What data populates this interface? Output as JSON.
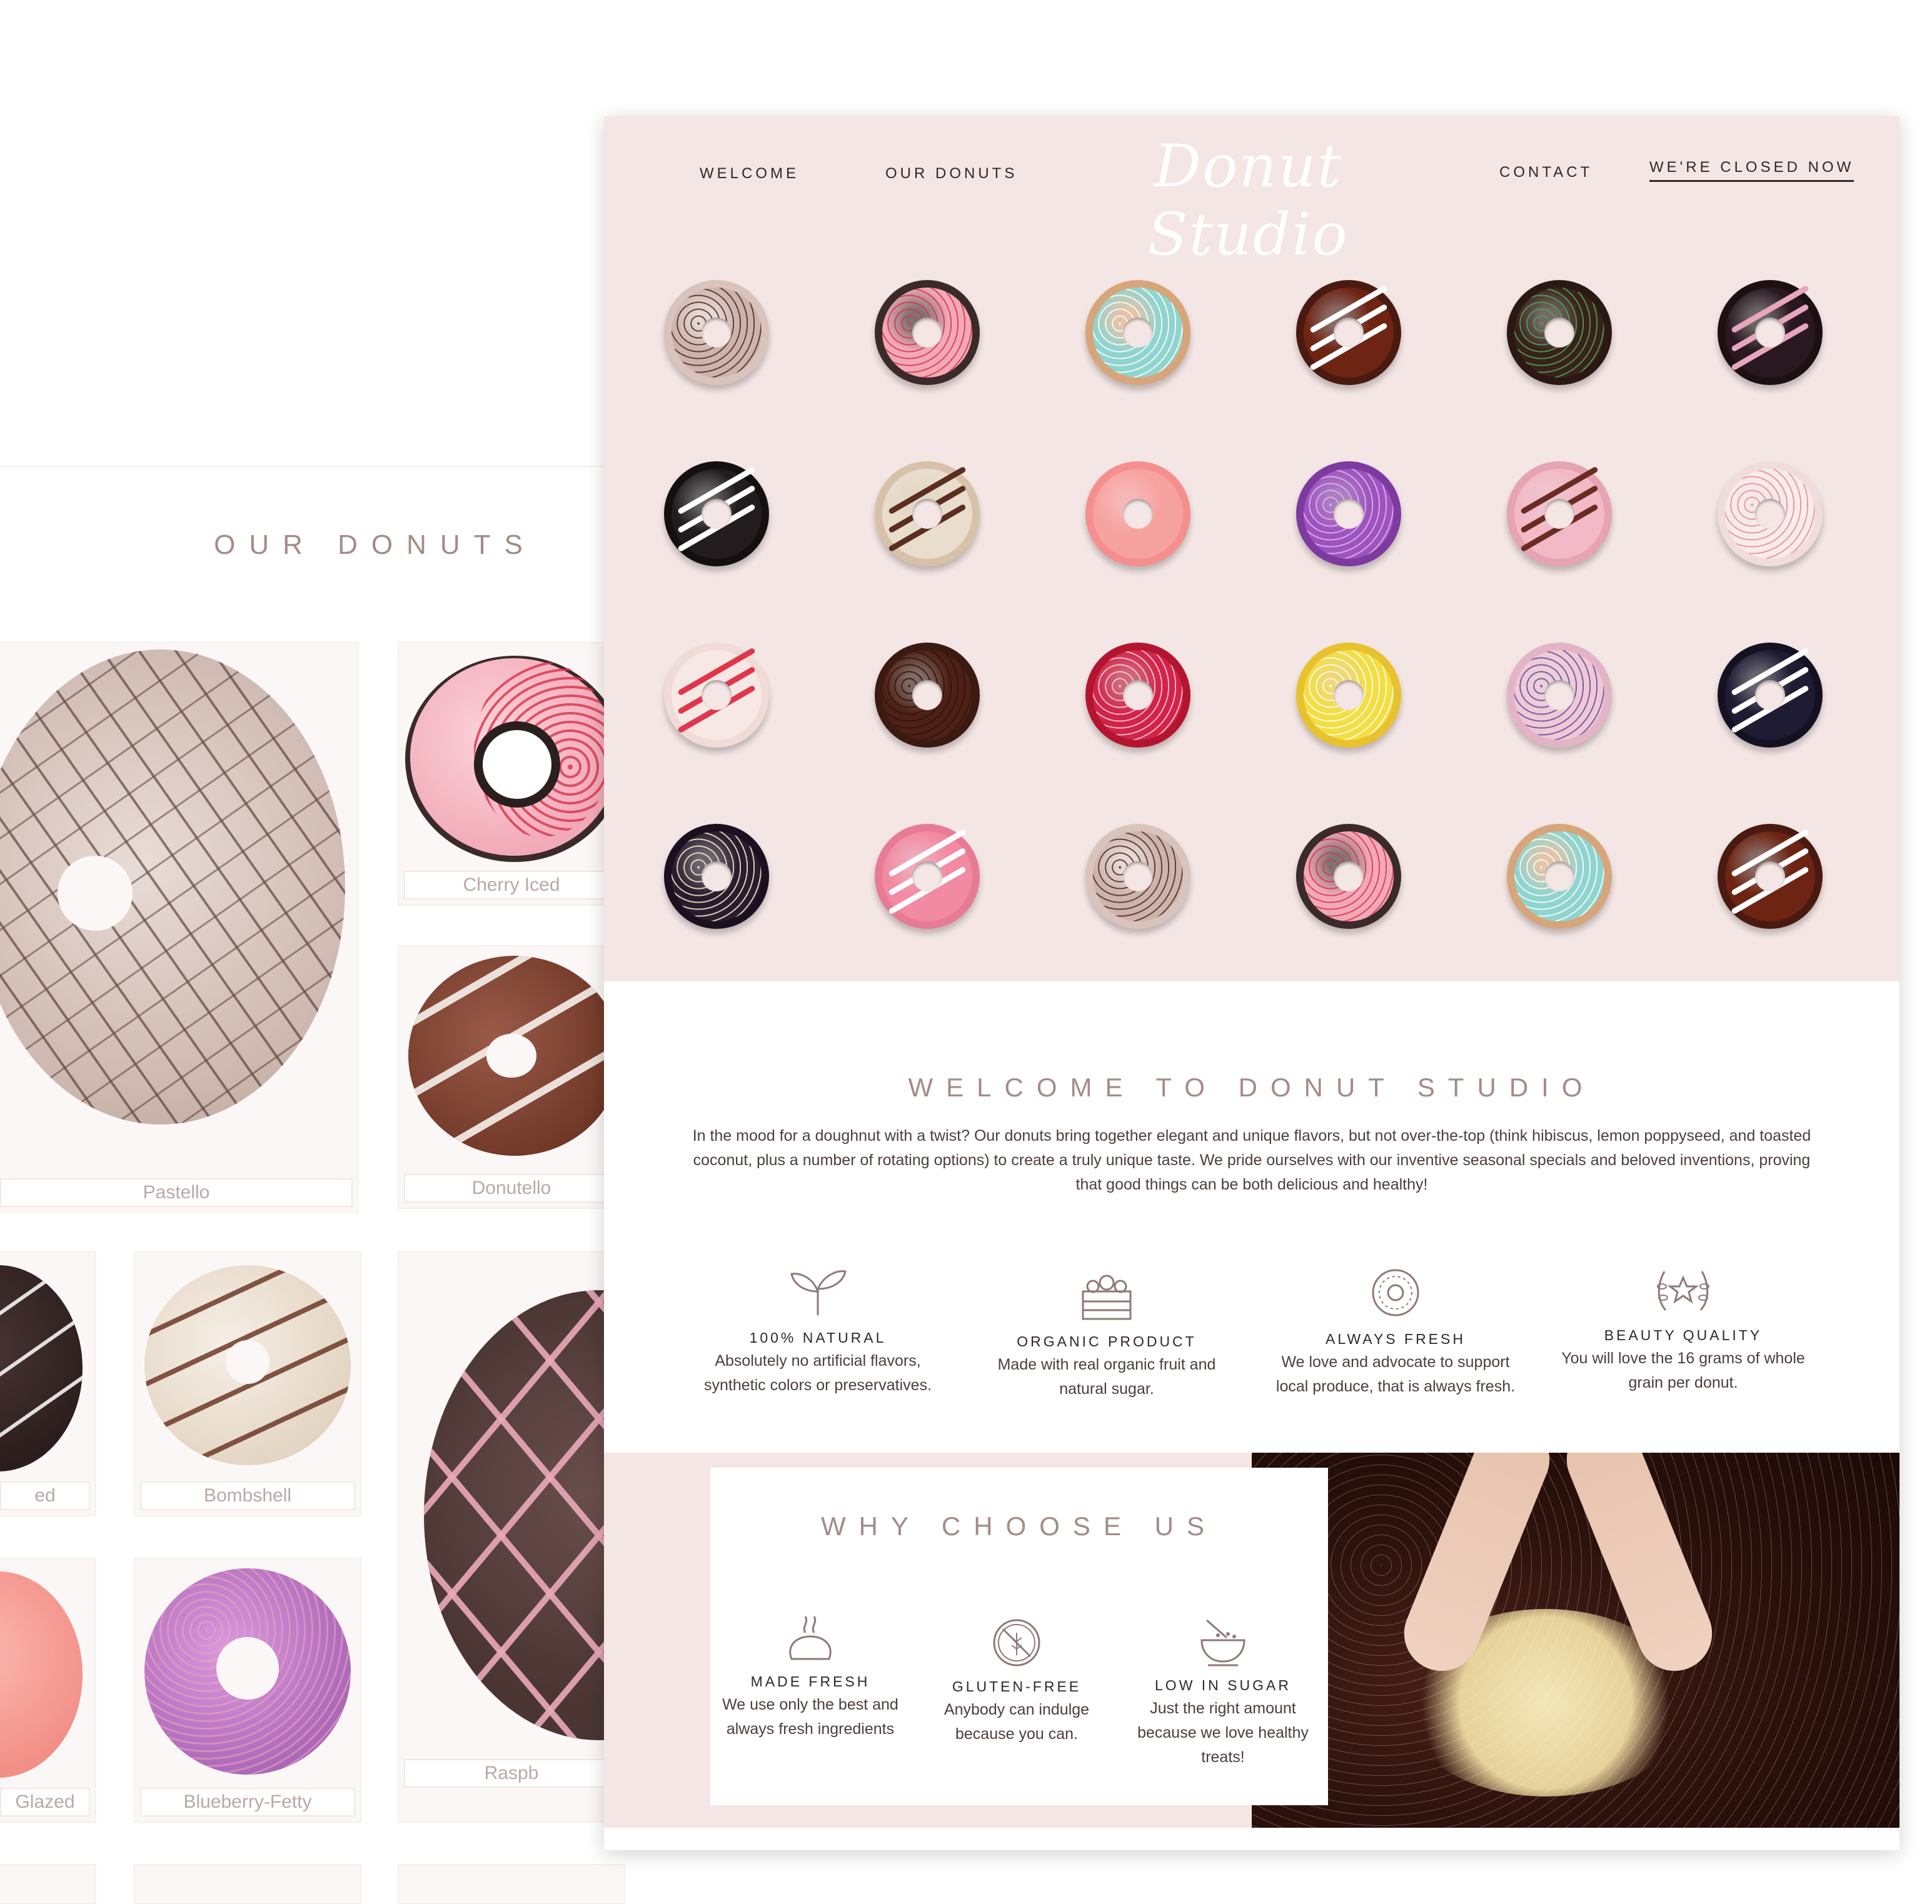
{
  "back_page": {
    "heading": "OUR DONUTS",
    "cards": [
      {
        "label": "Pastello"
      },
      {
        "label": "Cherry Iced"
      },
      {
        "label": "Donutello"
      },
      {
        "label": "ed"
      },
      {
        "label": "Bombshell"
      },
      {
        "label": "Raspb"
      },
      {
        "label": "Glazed"
      },
      {
        "label": "Blueberry-Fetty"
      }
    ]
  },
  "nav": {
    "welcome": "WELCOME",
    "our_donuts": "OUR DONUTS",
    "logo": "Donut Studio",
    "contact": "CONTACT",
    "status": "WE'RE CLOSED NOW"
  },
  "donut_grid": [
    {
      "base": "#d9c4bd",
      "glaze": "#cdb3ab",
      "topping": "#4a2b24",
      "style": "sprinkle"
    },
    {
      "base": "#3b2a2a",
      "glaze": "#f2a9b7",
      "topping": "#d9324c",
      "style": "sprinkle"
    },
    {
      "base": "#d7a57a",
      "glaze": "#8fd4cf",
      "topping": "#ffffff",
      "style": "sprinkle"
    },
    {
      "base": "#4a1a10",
      "glaze": "#6e2413",
      "topping": "#ffffff",
      "style": "stripe"
    },
    {
      "base": "#2b1813",
      "glaze": "#3a2119",
      "topping": "#48a85a",
      "style": "sprinkle"
    },
    {
      "base": "#1c1014",
      "glaze": "#2a1820",
      "topping": "#e7a6bb",
      "style": "stripe"
    },
    {
      "base": "#141012",
      "glaze": "#221c1f",
      "topping": "#ffffff",
      "style": "stripe"
    },
    {
      "base": "#d7c2a9",
      "glaze": "#e9ddcd",
      "topping": "#5b2e20",
      "style": "stripe"
    },
    {
      "base": "#f58f8f",
      "glaze": "#f6a3a0",
      "topping": "#fde0dc",
      "style": "plain"
    },
    {
      "base": "#7d3aa0",
      "glaze": "#9d54bf",
      "topping": "#e6b3ef",
      "style": "sprinkle"
    },
    {
      "base": "#e5a3b3",
      "glaze": "#f3b9c6",
      "topping": "#6a2b23",
      "style": "stripe"
    },
    {
      "base": "#f0dcda",
      "glaze": "#f8ecea",
      "topping": "#e48a9a",
      "style": "sprinkle"
    },
    {
      "base": "#f1dbd6",
      "glaze": "#f7e8e5",
      "topping": "#e0364b",
      "style": "stripe"
    },
    {
      "base": "#3b1a12",
      "glaze": "#4f2116",
      "topping": "#2b140d",
      "style": "sprinkle"
    },
    {
      "base": "#b3152f",
      "glaze": "#d2234a",
      "topping": "#ffd0da",
      "style": "sprinkle"
    },
    {
      "base": "#e8c22e",
      "glaze": "#f4de42",
      "topping": "#ffffff",
      "style": "sprinkle"
    },
    {
      "base": "#e3b4c6",
      "glaze": "#f1c8d6",
      "topping": "#5d4d9c",
      "style": "sprinkle"
    },
    {
      "base": "#141222",
      "glaze": "#1e1b33",
      "topping": "#ffffff",
      "style": "stripe"
    },
    {
      "base": "#1b1020",
      "glaze": "#2a1c2e",
      "topping": "#f3efc8",
      "style": "sprinkle"
    },
    {
      "base": "#e77b94",
      "glaze": "#f28aa3",
      "topping": "#ffffff",
      "style": "stripe"
    },
    {
      "base": "#d9c4bd",
      "glaze": "#cdb3ab",
      "topping": "#4a2b24",
      "style": "sprinkle"
    },
    {
      "base": "#3b2a2a",
      "glaze": "#f2a9b7",
      "topping": "#d9324c",
      "style": "sprinkle"
    },
    {
      "base": "#d7a57a",
      "glaze": "#8fd4cf",
      "topping": "#ffffff",
      "style": "sprinkle"
    },
    {
      "base": "#4a1a10",
      "glaze": "#6e2413",
      "topping": "#ffffff",
      "style": "stripe"
    }
  ],
  "welcome": {
    "title": "WELCOME TO DONUT STUDIO",
    "text": "In the mood for a doughnut with a twist? Our donuts bring together elegant and unique flavors, but not over-the-top (think hibiscus, lemon poppyseed, and toasted coconut, plus a number of rotating options) to create a truly unique taste. We pride ourselves with our inventive seasonal specials and beloved inventions, proving that good things can be both delicious and healthy!"
  },
  "features": [
    {
      "icon": "sprout-icon",
      "title": "100% NATURAL",
      "desc": "Absolutely no artificial flavors, synthetic colors or preservatives."
    },
    {
      "icon": "produce-crate-icon",
      "title": "ORGANIC PRODUCT",
      "desc": "Made with real organic fruit and natural sugar."
    },
    {
      "icon": "donut-icon",
      "title": "ALWAYS FRESH",
      "desc": "We love and advocate to support local produce, that is always fresh."
    },
    {
      "icon": "laurel-star-icon",
      "title": "BEAUTY QUALITY",
      "desc": "You will love the 16 grams of whole grain per donut."
    }
  ],
  "why": {
    "title": "WHY CHOOSE US",
    "items": [
      {
        "icon": "bread-steam-icon",
        "title": "MADE FRESH",
        "desc": "We use only the best and always fresh ingredients"
      },
      {
        "icon": "no-gluten-icon",
        "title": "GLUTEN-FREE",
        "desc": "Anybody can indulge because you can."
      },
      {
        "icon": "sugar-bowl-icon",
        "title": "LOW IN SUGAR",
        "desc": "Just the right amount because we love healthy treats!"
      }
    ]
  },
  "colors": {
    "hero_bg": "#f4e6e5",
    "accent_heading": "#a38c88",
    "text": "#4a3f3d"
  }
}
